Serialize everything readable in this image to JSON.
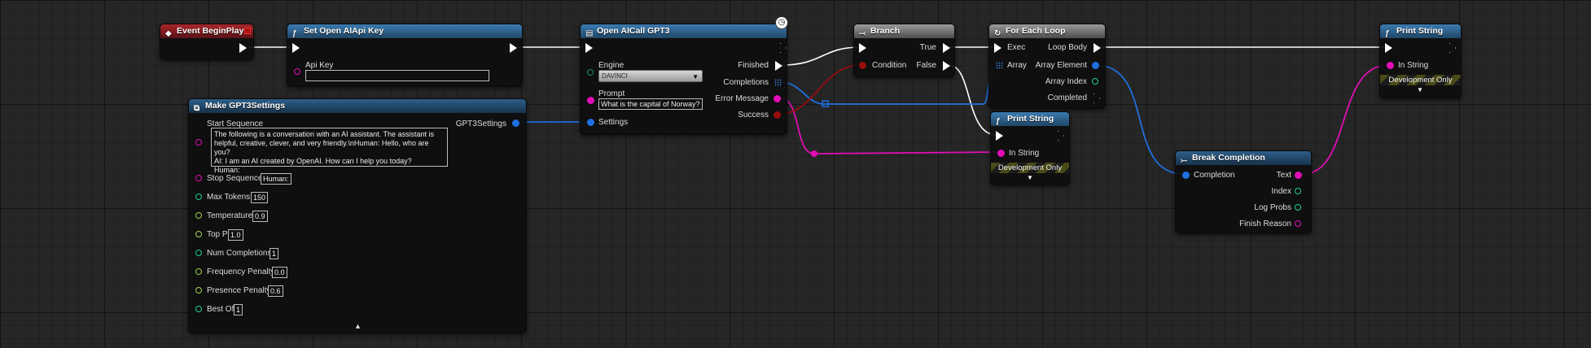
{
  "colors": {
    "exec_wire": "#ffffff",
    "string_pin": "#e30db7",
    "struct_pin": "#1f6fe0",
    "bool_pin": "#9a0d0d",
    "int_pin": "#1fcfa0",
    "float_pin": "#9cd64a",
    "event_header": "#a8262b",
    "function_header": "#3c7bb0"
  },
  "nodes": {
    "event_begin_play": {
      "title": "Event BeginPlay",
      "icon": "event-diamond-icon"
    },
    "set_api_key": {
      "title": "Set Open AIApi Key",
      "icon": "function-icon",
      "api_key_label": "Api Key",
      "api_key_value": ""
    },
    "make_settings": {
      "title": "Make GPT3Settings",
      "icon": "struct-icon",
      "output_label": "GPT3Settings",
      "start_sequence_label": "Start Sequence",
      "start_sequence_value": "The following is a conversation with an AI assistant. The assistant is\nhelpful, creative, clever, and very friendly.\\nHuman: Hello, who are you?\nAI: I am an AI created by OpenAI. How can I help you today?\nHuman:",
      "stop_sequence_label": "Stop Sequence",
      "stop_sequence_value": "Human:",
      "max_tokens_label": "Max Tokens",
      "max_tokens_value": "150",
      "temperature_label": "Temperature",
      "temperature_value": "0.9",
      "top_p_label": "Top P",
      "top_p_value": "1.0",
      "num_completions_label": "Num Completions",
      "num_completions_value": "1",
      "frequency_penalty_label": "Frequency Penalty",
      "frequency_penalty_value": "0.0",
      "presence_penalty_label": "Presence Penalty",
      "presence_penalty_value": "0.6",
      "best_of_label": "Best Of",
      "best_of_value": "1"
    },
    "open_ai_call": {
      "title": "Open AICall GPT3",
      "icon": "latent-clock-icon",
      "engine_label": "Engine",
      "engine_value": "DAVINCI",
      "prompt_label": "Prompt",
      "prompt_value": "What is the capital of Norway?",
      "settings_label": "Settings",
      "finished_label": "Finished",
      "completions_label": "Completions",
      "error_message_label": "Error Message",
      "success_label": "Success"
    },
    "branch": {
      "title": "Branch",
      "condition_label": "Condition",
      "true_label": "True",
      "false_label": "False"
    },
    "for_each": {
      "title": "For Each Loop",
      "exec_label": "Exec",
      "array_label": "Array",
      "loop_body_label": "Loop Body",
      "array_element_label": "Array Element",
      "array_index_label": "Array Index",
      "completed_label": "Completed"
    },
    "print_string_1": {
      "title": "Print String",
      "in_string_label": "In String",
      "dev_only": "Development Only"
    },
    "print_string_2": {
      "title": "Print String",
      "in_string_label": "In String",
      "dev_only": "Development Only"
    },
    "break_completion": {
      "title": "Break Completion",
      "completion_label": "Completion",
      "text_label": "Text",
      "index_label": "Index",
      "log_probs_label": "Log Probs",
      "finish_reason_label": "Finish Reason"
    }
  }
}
